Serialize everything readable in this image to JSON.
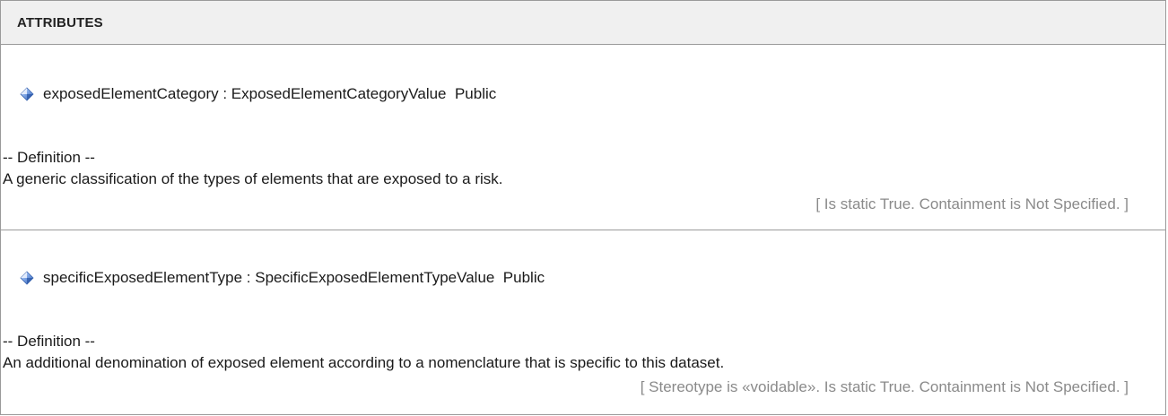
{
  "header": {
    "title": "ATTRIBUTES"
  },
  "attributes": [
    {
      "signature": "exposedElementCategory : ExposedElementCategoryValue  Public",
      "definition_label": "-- Definition --",
      "definition": "A generic classification of the types of elements that are exposed to a risk.",
      "properties": "[ Is static True. Containment is Not Specified. ]"
    },
    {
      "signature": "specificExposedElementType : SpecificExposedElementTypeValue  Public",
      "definition_label": "-- Definition --",
      "definition": "An additional denomination of exposed element according to a nomenclature that is specific to this dataset.",
      "properties": "[ Stereotype is «voidable». Is static True. Containment is Not Specified. ]"
    }
  ],
  "icons": {
    "attribute_icon": "attribute-gem-icon"
  },
  "colors": {
    "header_background": "#f0f0f0",
    "border": "#9a9a9a",
    "muted_text": "#8a8a8a",
    "icon_blue": "#4a78c8"
  }
}
